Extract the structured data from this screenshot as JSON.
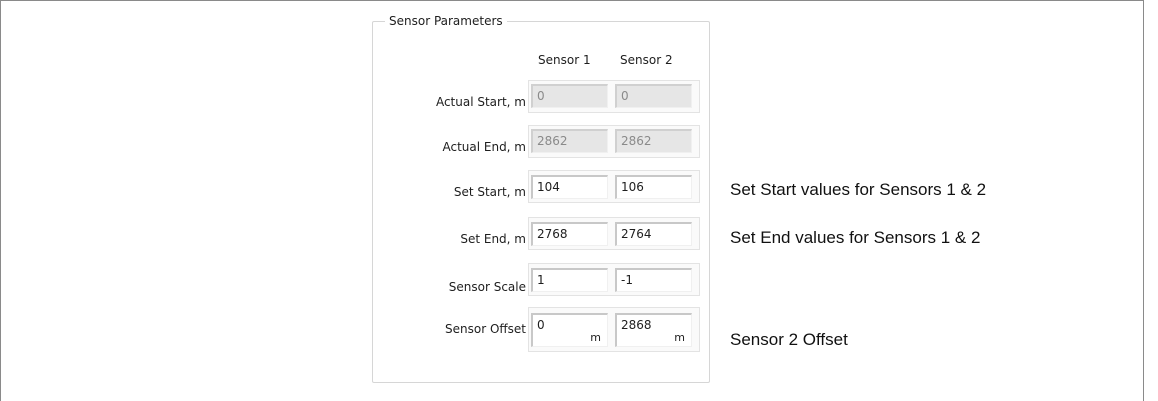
{
  "group": {
    "title": "Sensor Parameters",
    "columns": [
      "Sensor 1",
      "Sensor 2"
    ]
  },
  "rows": [
    {
      "label": "Actual Start, m",
      "s1": "0",
      "s2": "0",
      "disabled": true
    },
    {
      "label": "Actual End, m",
      "s1": "2862",
      "s2": "2862",
      "disabled": true
    },
    {
      "label": "Set Start, m",
      "s1": "104",
      "s2": "106",
      "disabled": false
    },
    {
      "label": "Set End, m",
      "s1": "2768",
      "s2": "2764",
      "disabled": false
    },
    {
      "label": "Sensor Scale",
      "s1": "1",
      "s2": "-1",
      "disabled": false
    },
    {
      "label": "Sensor Offset",
      "s1": "0",
      "s2": "2868",
      "disabled": false,
      "unit": "m"
    }
  ],
  "annotations": {
    "set_start": "Set Start values for Sensors 1 & 2",
    "set_end": "Set End values for Sensors 1 & 2",
    "offset": "Sensor 2 Offset"
  },
  "colors": {
    "disabled_field_bg": "#e6e6e6",
    "disabled_text": "#8a8a8a",
    "text": "#1e1e1e"
  }
}
